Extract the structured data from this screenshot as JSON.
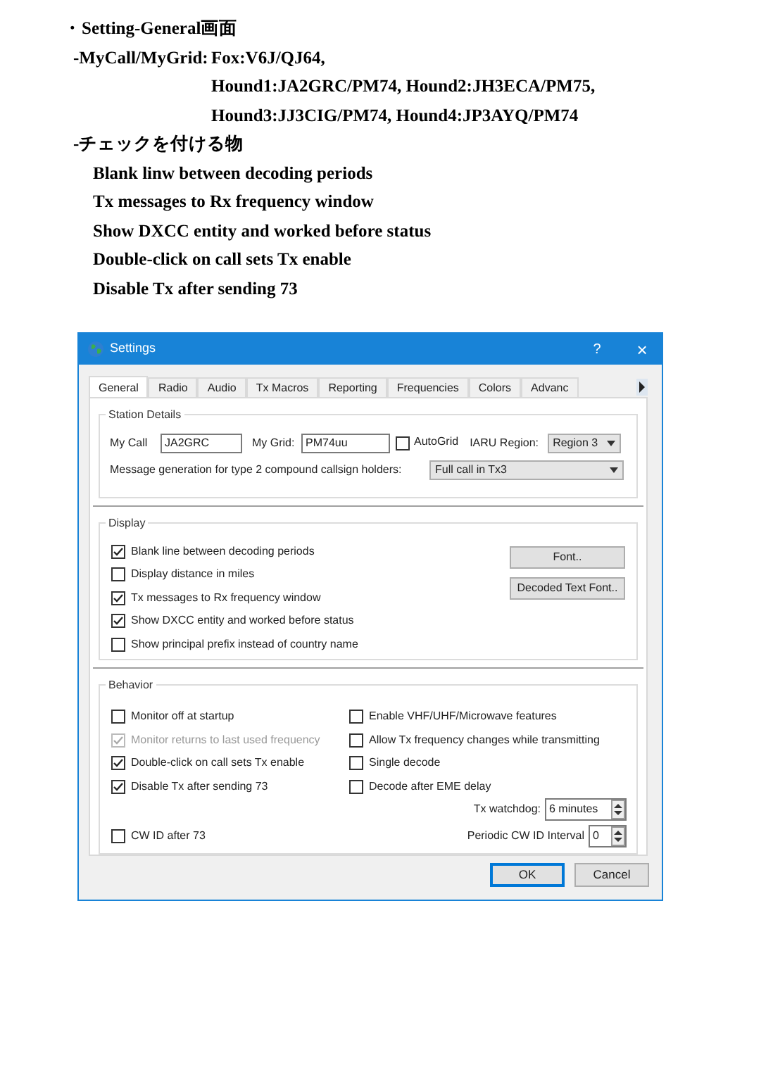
{
  "notes": {
    "title": "・Setting-General画面",
    "sections": [
      {
        "kind": "inline",
        "label": "-MyCall/MyGrid:",
        "lines": [
          "Fox:V6J/QJ64,",
          "Hound1:JA2GRC/PM74, Hound2:JH3ECA/PM75,",
          "Hound3:JJ3CIG/PM74, Hound4:JP3AYQ/PM74"
        ]
      },
      {
        "kind": "block",
        "label": "-チェックを付ける物",
        "lines": [
          "Blank linw between decoding periods",
          "Tx messages to Rx frequency window",
          "Show DXCC entity and worked before status",
          "Double-click on call sets Tx enable",
          "Disable Tx after sending 73"
        ]
      }
    ]
  },
  "dialog": {
    "title": "Settings",
    "help": "?",
    "close": "×",
    "tabs": [
      {
        "label": "General",
        "selected": true
      },
      {
        "label": "Radio",
        "selected": false
      },
      {
        "label": "Audio",
        "selected": false
      },
      {
        "label": "Tx Macros",
        "selected": false
      },
      {
        "label": "Reporting",
        "selected": false
      },
      {
        "label": "Frequencies",
        "selected": false
      },
      {
        "label": "Colors",
        "selected": false
      },
      {
        "label": "Advanc",
        "selected": false
      }
    ],
    "station_details": {
      "title": "Station Details",
      "my_call": {
        "label": "My Call",
        "value": "JA2GRC"
      },
      "my_grid": {
        "label": "My Grid:",
        "value": "PM74uu"
      },
      "autogrid": {
        "label": "AutoGrid",
        "checked": false
      },
      "iaru_region": {
        "label": "IARU Region:",
        "value": "Region 3"
      },
      "message_generation": {
        "label": "Message generation for type 2 compound callsign holders:",
        "value": "Full call in Tx3"
      }
    },
    "display": {
      "title": "Display",
      "options": [
        {
          "label": "Blank line between decoding periods",
          "checked": true
        },
        {
          "label": "Display distance in miles",
          "checked": false
        },
        {
          "label": "Tx messages to Rx frequency window",
          "checked": true
        },
        {
          "label": "Show DXCC entity and worked before status",
          "checked": true
        },
        {
          "label": "Show principal prefix instead of country name",
          "checked": false
        }
      ],
      "buttons": [
        "Font..",
        "Decoded Text Font.."
      ]
    },
    "behavior": {
      "title": "Behavior",
      "left": [
        {
          "label": "Monitor off at startup",
          "checked": false,
          "disabled": false
        },
        {
          "label": "Monitor returns to last used frequency",
          "checked": true,
          "disabled": true
        },
        {
          "label": "Double-click on call sets Tx enable",
          "checked": true,
          "disabled": false
        },
        {
          "label": "Disable Tx after sending 73",
          "checked": true,
          "disabled": false
        }
      ],
      "right": [
        {
          "label": "Enable VHF/UHF/Microwave features",
          "checked": false,
          "disabled": false
        },
        {
          "label": "Allow Tx frequency changes while transmitting",
          "checked": false,
          "disabled": false
        },
        {
          "label": "Single decode",
          "checked": false,
          "disabled": false
        },
        {
          "label": "Decode after EME delay",
          "checked": false,
          "disabled": false
        }
      ],
      "tx_watchdog": {
        "label": "Tx watchdog:",
        "value": "6 minutes"
      },
      "cw_id_after_73": {
        "label": "CW ID after 73",
        "checked": false
      },
      "cw_id_interval": {
        "label": "Periodic CW ID Interval",
        "value": "0"
      }
    },
    "buttons": [
      {
        "label": "OK",
        "default": true
      },
      {
        "label": "Cancel",
        "default": false
      }
    ]
  }
}
